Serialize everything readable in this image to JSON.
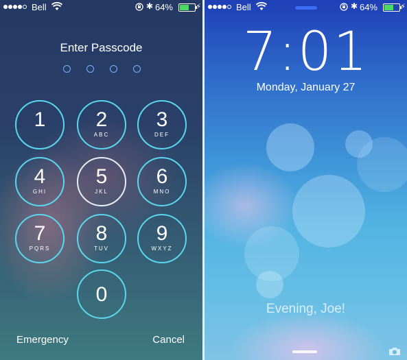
{
  "status_bar": {
    "carrier": "Bell",
    "battery_percent": "64%",
    "battery_level": 0.64,
    "signal_bars": 4
  },
  "passcode_screen": {
    "title": "Enter Passcode",
    "digits_entered": 0,
    "keys": [
      {
        "num": "1",
        "letters": ""
      },
      {
        "num": "2",
        "letters": "ABC"
      },
      {
        "num": "3",
        "letters": "DEF"
      },
      {
        "num": "4",
        "letters": "GHI"
      },
      {
        "num": "5",
        "letters": "JKL"
      },
      {
        "num": "6",
        "letters": "MNO"
      },
      {
        "num": "7",
        "letters": "PQRS"
      },
      {
        "num": "8",
        "letters": "TUV"
      },
      {
        "num": "9",
        "letters": "WXYZ"
      },
      {
        "num": "0",
        "letters": ""
      }
    ],
    "emergency_label": "Emergency",
    "cancel_label": "Cancel"
  },
  "lock_screen": {
    "time": "7:01",
    "date": "Monday, January 27",
    "greeting": "Evening, Joe!"
  },
  "colors": {
    "key_ring": "#5ad7ef",
    "pressed_ring": "#e6eef5",
    "battery_fill": "#4cd964",
    "pin_dot": "#7fb2ff"
  },
  "icons": [
    "wifi-icon",
    "rotation-lock-icon",
    "bluetooth-icon",
    "battery-icon",
    "charging-bolt-icon",
    "camera-icon"
  ]
}
